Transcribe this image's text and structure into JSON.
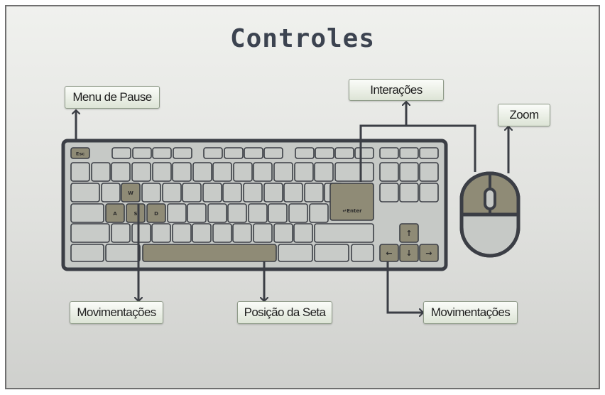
{
  "title": "Controles",
  "labels": {
    "menu_pause": "Menu de Pause",
    "interactions": "Interações",
    "zoom": "Zoom",
    "movements_left": "Movimentações",
    "arrow_position": "Posição da Seta",
    "movements_right": "Movimentações"
  },
  "keys": {
    "esc": "Esc",
    "w": "W",
    "a": "A",
    "s": "S",
    "d": "D",
    "enter": "↵Enter",
    "arrow_up": "↑",
    "arrow_left": "←",
    "arrow_down": "↓",
    "arrow_right": "→"
  },
  "colors": {
    "key_face": "#c8cbc8",
    "highlight_key": "#8f8b76",
    "outline": "#3b3e45",
    "arrow_line": "#3b3e45"
  }
}
